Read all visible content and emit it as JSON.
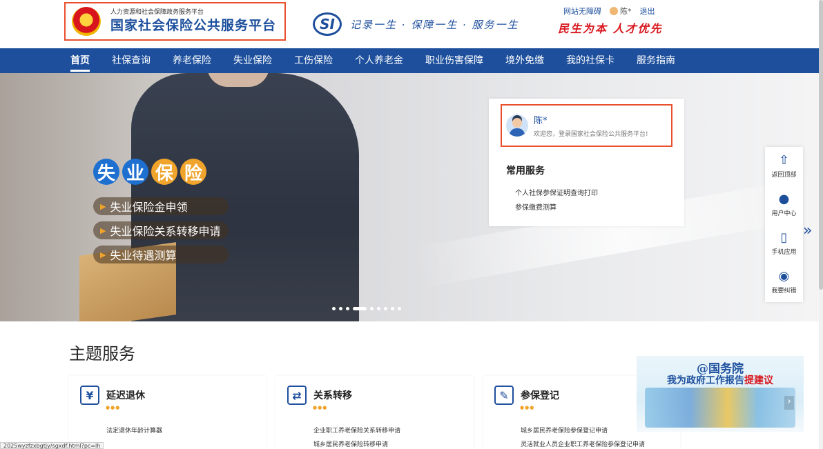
{
  "header": {
    "logo_sub": "人力资源和社会保障政务服务平台",
    "logo_main": "国家社会保险公共服务平台",
    "si_mark": "SI",
    "si_slogan": "记录一生 · 保障一生 · 服务一生",
    "accessibility": "网站无障碍",
    "user_name": "陈*",
    "logout": "退出",
    "red_slogan": "民生为本 人才优先"
  },
  "nav": {
    "items": [
      {
        "label": "首页"
      },
      {
        "label": "社保查询"
      },
      {
        "label": "养老保险"
      },
      {
        "label": "失业保险"
      },
      {
        "label": "工伤保险"
      },
      {
        "label": "个人养老金"
      },
      {
        "label": "职业伤害保障"
      },
      {
        "label": "境外免缴"
      },
      {
        "label": "我的社保卡"
      },
      {
        "label": "服务指南"
      }
    ]
  },
  "banner": {
    "title_chars": [
      {
        "char": "失",
        "color": "#1d6fd0"
      },
      {
        "char": "业",
        "color": "#1d6fd0"
      },
      {
        "char": "保",
        "color": "#f0a42b"
      },
      {
        "char": "险",
        "color": "#f0a42b"
      }
    ],
    "menu": [
      "失业保险金申领",
      "失业保险关系转移申请",
      "失业待遇测算"
    ]
  },
  "user_card": {
    "name": "陈*",
    "welcome": "欢迎您，登录国家社会保险公共服务平台!",
    "common_title": "常用服务",
    "links": [
      "个人社保参保证明查询打印",
      "参保缴费测算"
    ]
  },
  "side_toolbar": {
    "items": [
      {
        "icon": "arrow-up-icon",
        "glyph": "⇧",
        "label": "返回顶部"
      },
      {
        "icon": "user-icon",
        "glyph": "●",
        "label": "用户中心"
      },
      {
        "icon": "phone-icon",
        "glyph": "▯",
        "label": "手机应用"
      },
      {
        "icon": "feedback-icon",
        "glyph": "◉",
        "label": "我要纠错"
      }
    ]
  },
  "theme": {
    "title": "主题服务",
    "cards": [
      {
        "icon": "yen-icon",
        "glyph": "¥",
        "title": "延迟退休",
        "links": [
          "法定退休年龄计算器"
        ]
      },
      {
        "icon": "transfer-icon",
        "glyph": "⇄",
        "title": "关系转移",
        "links": [
          "企业职工养老保险关系转移申请",
          "城乡居民养老保险转移申请"
        ]
      },
      {
        "icon": "register-icon",
        "glyph": "✎",
        "title": "参保登记",
        "links": [
          "城乡居民养老保险参保登记申请",
          "灵活就业人员企业职工养老保险参保登记申请"
        ]
      }
    ]
  },
  "promo": {
    "line1": "@国务院",
    "line2_prefix": "我为政府工作报告",
    "line2_highlight": "提建议"
  },
  "status_url": "2025wyzfzxbgtjy/sgxdf.html?pc=lh",
  "colors": {
    "primary": "#1d4f9d",
    "highlight_border": "#e8502e",
    "red": "#d8151c",
    "accent": "#f0a42b"
  }
}
